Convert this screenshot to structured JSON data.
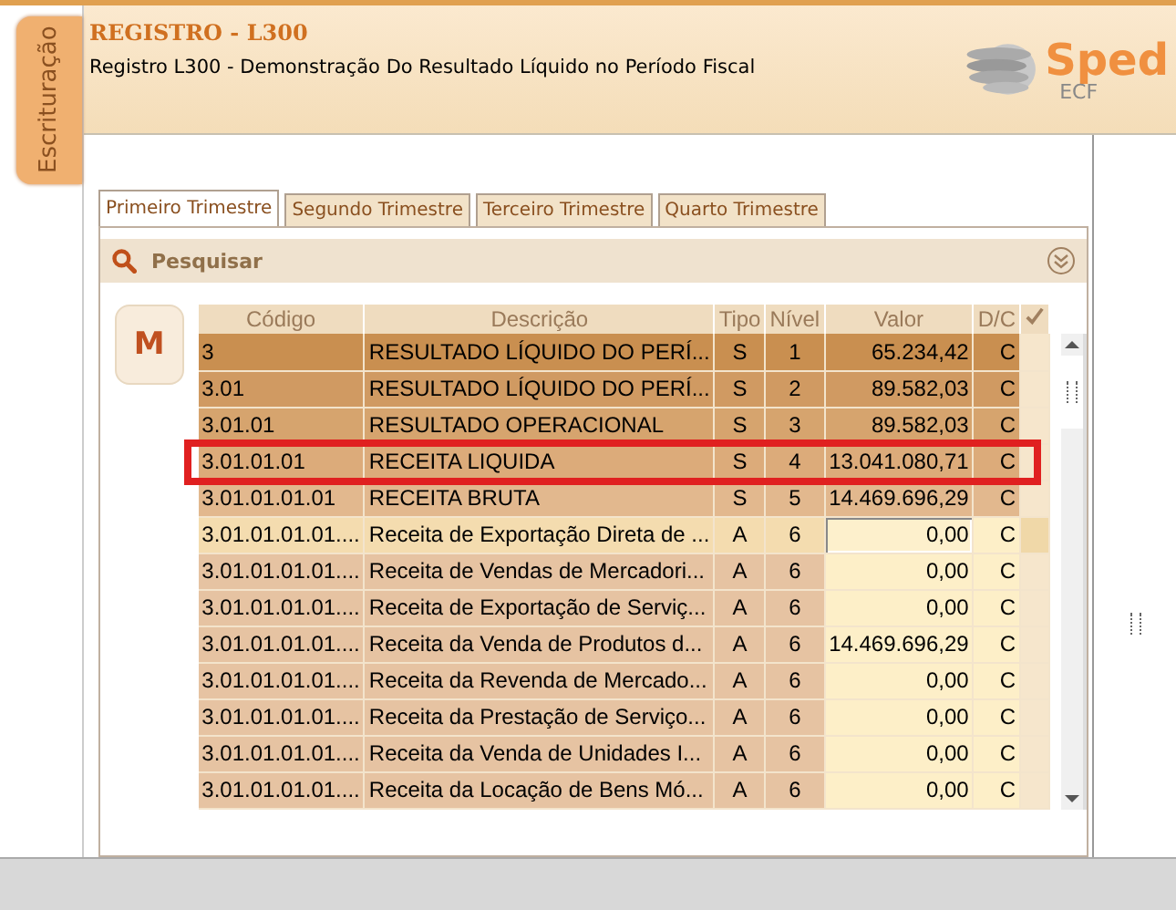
{
  "side_tab": {
    "label": "Escrituração"
  },
  "header": {
    "title": "REGISTRO - L300",
    "subtitle": "Registro L300 - Demonstração Do Resultado Líquido no Período Fiscal",
    "logo_text": "Sped",
    "logo_subtext": "ECF"
  },
  "tabs": [
    {
      "label": "Primeiro Trimestre",
      "selected": true
    },
    {
      "label": "Segundo Trimestre",
      "selected": false
    },
    {
      "label": "Terceiro Trimestre",
      "selected": false
    },
    {
      "label": "Quarto Trimestre",
      "selected": false
    }
  ],
  "search": {
    "label": "Pesquisar"
  },
  "mode_button": {
    "label": "M"
  },
  "table": {
    "columns": [
      "Código",
      "Descrição",
      "Tipo",
      "Nível",
      "Valor",
      "D/C"
    ],
    "rows": [
      {
        "codigo": "3",
        "descricao": "RESULTADO LÍQUIDO DO PERÍ...",
        "tipo": "S",
        "nivel": "1",
        "valor": "65.234,42",
        "dc": "C",
        "selected": false,
        "highlighted": false
      },
      {
        "codigo": "3.01",
        "descricao": "RESULTADO LÍQUIDO DO PERÍ...",
        "tipo": "S",
        "nivel": "2",
        "valor": "89.582,03",
        "dc": "C",
        "selected": false,
        "highlighted": false
      },
      {
        "codigo": "3.01.01",
        "descricao": "RESULTADO OPERACIONAL",
        "tipo": "S",
        "nivel": "3",
        "valor": "89.582,03",
        "dc": "C",
        "selected": false,
        "highlighted": false
      },
      {
        "codigo": "3.01.01.01",
        "descricao": "RECEITA LIQUIDA",
        "tipo": "S",
        "nivel": "4",
        "valor": "13.041.080,71",
        "dc": "C",
        "selected": false,
        "highlighted": true
      },
      {
        "codigo": "3.01.01.01.01",
        "descricao": "RECEITA BRUTA",
        "tipo": "S",
        "nivel": "5",
        "valor": "14.469.696,29",
        "dc": "C",
        "selected": false,
        "highlighted": false
      },
      {
        "codigo": "3.01.01.01.01....",
        "descricao": "Receita de Exportação Direta de ...",
        "tipo": "A",
        "nivel": "6",
        "valor": "0,00",
        "dc": "C",
        "selected": true,
        "highlighted": false
      },
      {
        "codigo": "3.01.01.01.01....",
        "descricao": "Receita de Vendas de Mercadori...",
        "tipo": "A",
        "nivel": "6",
        "valor": "0,00",
        "dc": "C",
        "selected": false,
        "highlighted": false
      },
      {
        "codigo": "3.01.01.01.01....",
        "descricao": "Receita de Exportação de Serviç...",
        "tipo": "A",
        "nivel": "6",
        "valor": "0,00",
        "dc": "C",
        "selected": false,
        "highlighted": false
      },
      {
        "codigo": "3.01.01.01.01....",
        "descricao": "Receita da Venda de Produtos d...",
        "tipo": "A",
        "nivel": "6",
        "valor": "14.469.696,29",
        "dc": "C",
        "selected": false,
        "highlighted": false
      },
      {
        "codigo": "3.01.01.01.01....",
        "descricao": "Receita da Revenda de Mercado...",
        "tipo": "A",
        "nivel": "6",
        "valor": "0,00",
        "dc": "C",
        "selected": false,
        "highlighted": false
      },
      {
        "codigo": "3.01.01.01.01....",
        "descricao": "Receita da Prestação de Serviço...",
        "tipo": "A",
        "nivel": "6",
        "valor": "0,00",
        "dc": "C",
        "selected": false,
        "highlighted": false
      },
      {
        "codigo": "3.01.01.01.01....",
        "descricao": "Receita da Venda de Unidades I...",
        "tipo": "A",
        "nivel": "6",
        "valor": "0,00",
        "dc": "C",
        "selected": false,
        "highlighted": false
      },
      {
        "codigo": "3.01.01.01.01....",
        "descricao": "Receita da Locação de Bens Mó...",
        "tipo": "A",
        "nivel": "6",
        "valor": "0,00",
        "dc": "C",
        "selected": false,
        "highlighted": false
      }
    ]
  }
}
